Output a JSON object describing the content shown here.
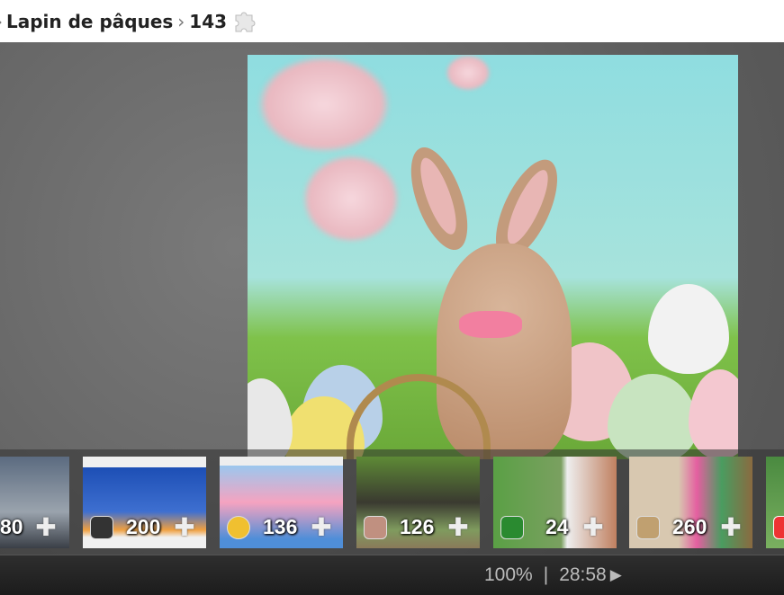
{
  "breadcrumb": {
    "prefix_arrow": "›",
    "category": "Lapin de pâques",
    "separator": "›",
    "pieces": "143",
    "puzzle_icon": "puzzle-piece-icon"
  },
  "thumbnails": [
    {
      "count": "80",
      "bg": "linear-gradient(#5b6b80,#9aa3ad 60%,#3a3f47)"
    },
    {
      "count": "200",
      "bg": "linear-gradient(#f0f0f0 12%,#1d4fb5 12%,#3e6fd0 60%,#f0a040 80%,#f0f0f0 88%)"
    },
    {
      "count": "136",
      "bg": "linear-gradient(#eee 10%,#9cc7ee 10%,#f5a3c0 50%,#4f8ed8 90%)"
    },
    {
      "count": "126",
      "bg": "linear-gradient(#5e8a36,#3a3a30 50%,#7f9b5e 80%,#8a7a5a)"
    },
    {
      "count": "24",
      "bg": "linear-gradient(90deg,#5aa045,#7aa060 55%,#eee 60%,#c08060)"
    },
    {
      "count": "260",
      "bg": "linear-gradient(90deg,#d8c8b0 40%,#e45fa0 55%,#4a9c60 75%,#8a6a40)"
    },
    {
      "count": "",
      "bg": "linear-gradient(#4a8a40,#7ab060)"
    }
  ],
  "status": {
    "zoom": "100%",
    "divider": "|",
    "timer": "28:58",
    "play_icon": "▶"
  }
}
